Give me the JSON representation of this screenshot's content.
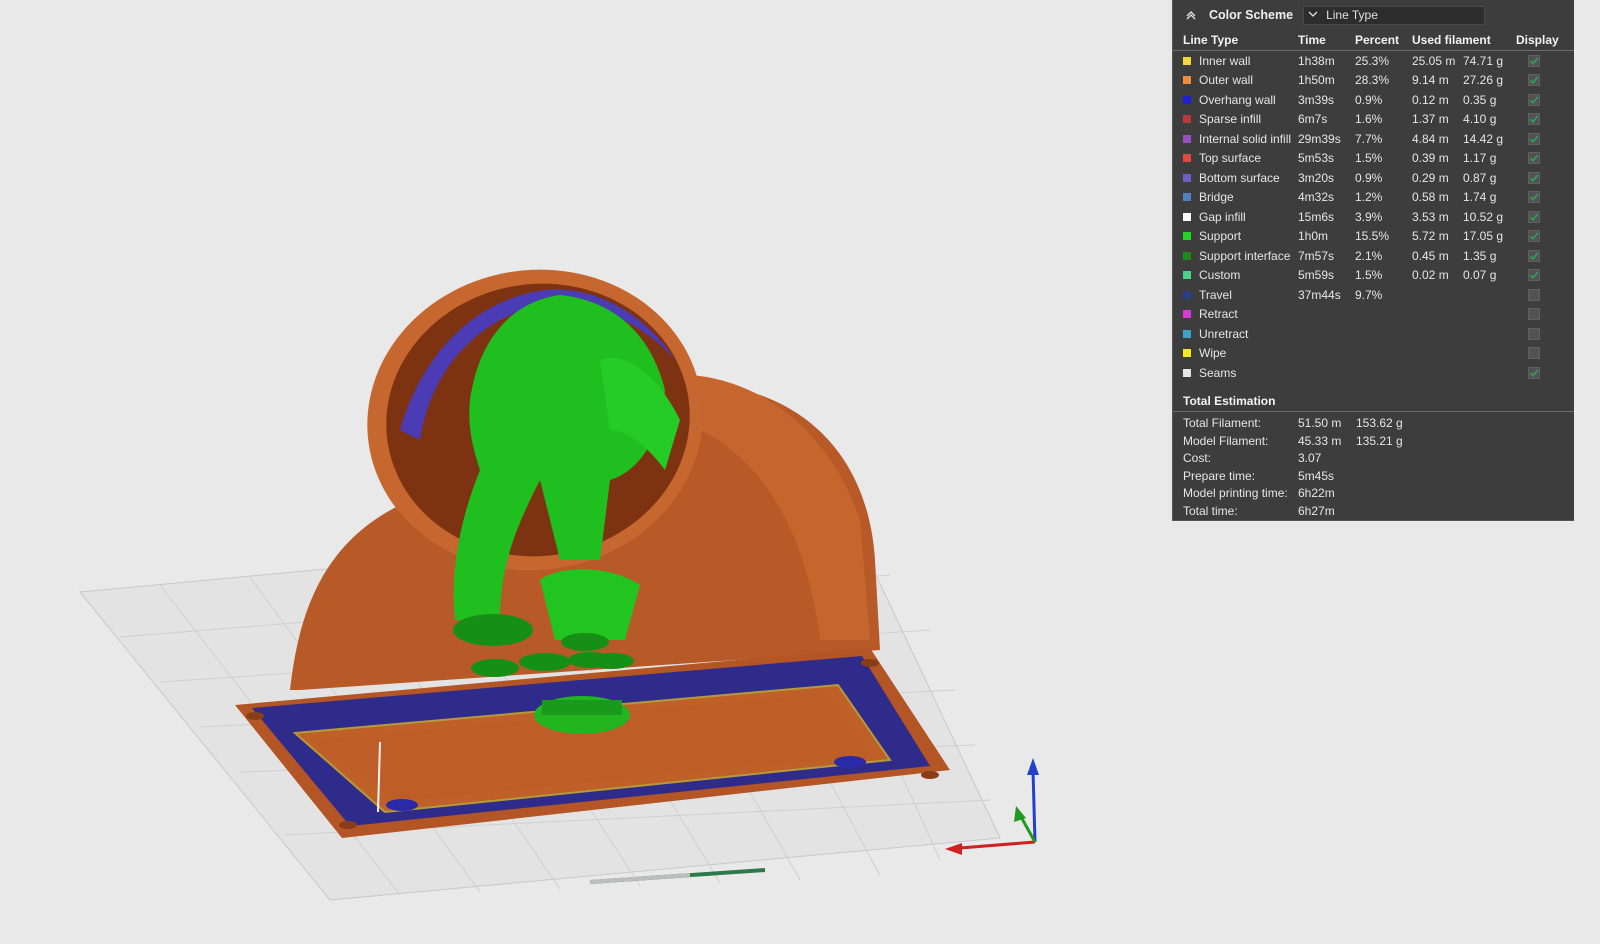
{
  "panel": {
    "title": "Color Scheme",
    "scheme_select": "Line Type",
    "headers": [
      "Line Type",
      "Time",
      "Percent",
      "Used filament",
      "Display"
    ],
    "rows": [
      {
        "name": "Inner wall",
        "color": "#f2d63a",
        "time": "1h38m",
        "percent": "25.3%",
        "length": "25.05 m",
        "weight": "74.71 g",
        "checked": true
      },
      {
        "name": "Outer wall",
        "color": "#f08a3e",
        "time": "1h50m",
        "percent": "28.3%",
        "length": "9.14 m",
        "weight": "27.26 g",
        "checked": true
      },
      {
        "name": "Overhang wall",
        "color": "#1f1fd6",
        "time": "3m39s",
        "percent": "0.9%",
        "length": "0.12 m",
        "weight": "0.35 g",
        "checked": true
      },
      {
        "name": "Sparse infill",
        "color": "#b83a3a",
        "time": "6m7s",
        "percent": "1.6%",
        "length": "1.37 m",
        "weight": "4.10 g",
        "checked": true
      },
      {
        "name": "Internal solid infill",
        "color": "#9a4fc4",
        "time": "29m39s",
        "percent": "7.7%",
        "length": "4.84 m",
        "weight": "14.42 g",
        "checked": true
      },
      {
        "name": "Top surface",
        "color": "#e34a3c",
        "time": "5m53s",
        "percent": "1.5%",
        "length": "0.39 m",
        "weight": "1.17 g",
        "checked": true
      },
      {
        "name": "Bottom surface",
        "color": "#6b5fc9",
        "time": "3m20s",
        "percent": "0.9%",
        "length": "0.29 m",
        "weight": "0.87 g",
        "checked": true
      },
      {
        "name": "Bridge",
        "color": "#4f7fc4",
        "time": "4m32s",
        "percent": "1.2%",
        "length": "0.58 m",
        "weight": "1.74 g",
        "checked": true
      },
      {
        "name": "Gap infill",
        "color": "#ffffff",
        "time": "15m6s",
        "percent": "3.9%",
        "length": "3.53 m",
        "weight": "10.52 g",
        "checked": true
      },
      {
        "name": "Support",
        "color": "#22d322",
        "time": "1h0m",
        "percent": "15.5%",
        "length": "5.72 m",
        "weight": "17.05 g",
        "checked": true
      },
      {
        "name": "Support interface",
        "color": "#1c8a1c",
        "time": "7m57s",
        "percent": "2.1%",
        "length": "0.45 m",
        "weight": "1.35 g",
        "checked": true
      },
      {
        "name": "Custom",
        "color": "#4fd08a",
        "time": "5m59s",
        "percent": "1.5%",
        "length": "0.02 m",
        "weight": "0.07 g",
        "checked": true
      },
      {
        "name": "Travel",
        "color": "#2a3f8c",
        "time": "37m44s",
        "percent": "9.7%",
        "length": "",
        "weight": "",
        "checked": false
      },
      {
        "name": "Retract",
        "color": "#d83bd8",
        "time": "",
        "percent": "",
        "length": "",
        "weight": "",
        "checked": false
      },
      {
        "name": "Unretract",
        "color": "#3fa3c9",
        "time": "",
        "percent": "",
        "length": "",
        "weight": "",
        "checked": false
      },
      {
        "name": "Wipe",
        "color": "#f2ea1f",
        "time": "",
        "percent": "",
        "length": "",
        "weight": "",
        "checked": false
      },
      {
        "name": "Seams",
        "color": "#e6e6e6",
        "time": "",
        "percent": "",
        "length": "",
        "weight": "",
        "checked": true
      }
    ],
    "total_title": "Total Estimation",
    "totals": [
      {
        "label": "Total Filament:",
        "v1": "51.50 m",
        "v2": "153.62 g"
      },
      {
        "label": "Model Filament:",
        "v1": "45.33 m",
        "v2": "135.21 g"
      },
      {
        "label": "Cost:",
        "v1": "3.07",
        "v2": ""
      },
      {
        "label": "Prepare time:",
        "v1": "5m45s",
        "v2": ""
      },
      {
        "label": "Model printing time:",
        "v1": "6h22m",
        "v2": ""
      },
      {
        "label": "Total time:",
        "v1": "6h27m",
        "v2": ""
      }
    ]
  },
  "colors": {
    "model": "#c1622c",
    "support": "#22c41f",
    "flange": "#2e2a86",
    "panel_bg": "#3d3d3d",
    "check": "#2fa35a"
  }
}
